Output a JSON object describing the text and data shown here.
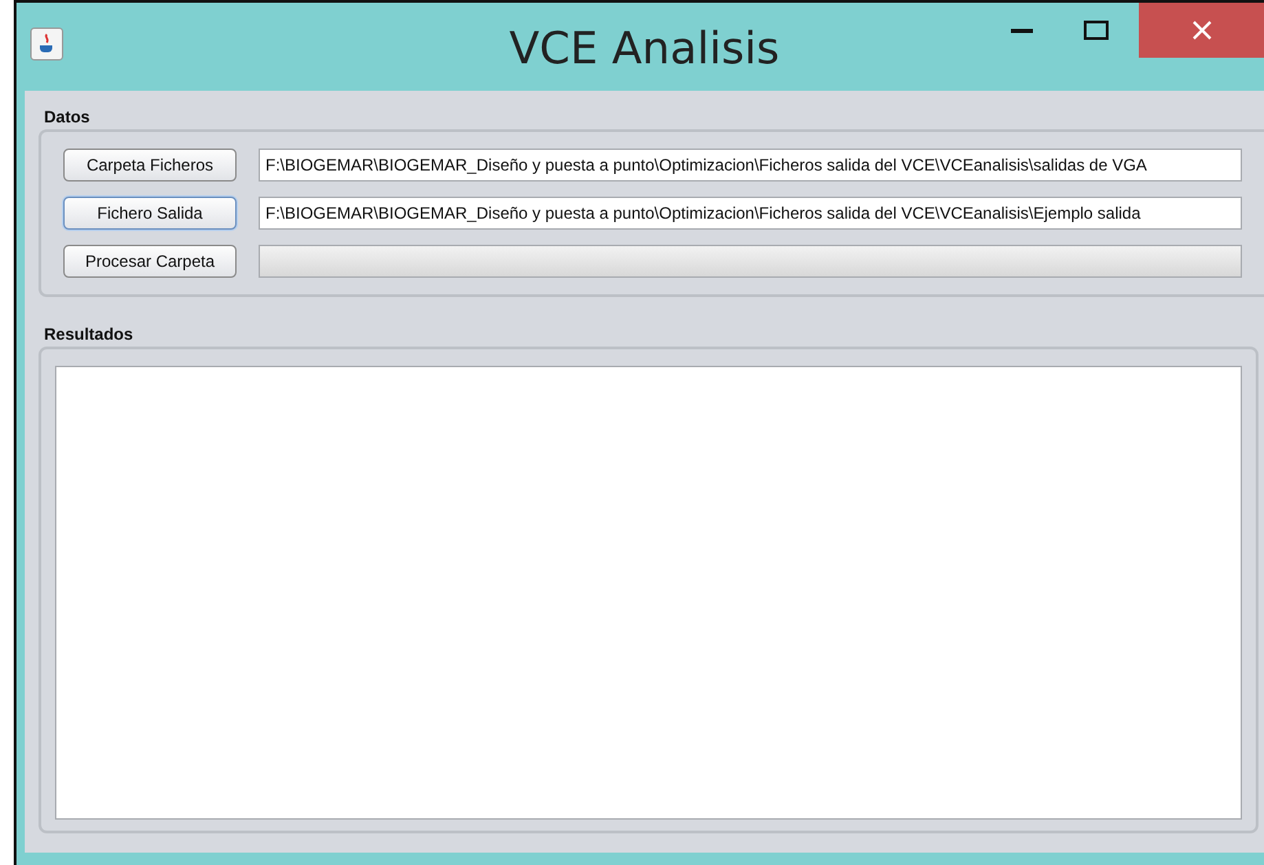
{
  "window": {
    "title": "VCE Analisis"
  },
  "datos": {
    "title": "Datos",
    "rows": [
      {
        "kind": "field",
        "button": "Carpeta Ficheros",
        "focused": false,
        "value": "F:\\BIOGEMAR\\BIOGEMAR_Diseño y puesta a punto\\Optimizacion\\Ficheros salida del VCE\\VCEanalisis\\salidas de VGA"
      },
      {
        "kind": "field",
        "button": "Fichero Salida",
        "focused": true,
        "value": "F:\\BIOGEMAR\\BIOGEMAR_Diseño y puesta a punto\\Optimizacion\\Ficheros salida del VCE\\VCEanalisis\\Ejemplo salida"
      },
      {
        "kind": "progress",
        "button": "Procesar Carpeta",
        "focused": false,
        "level": 0
      }
    ]
  },
  "resultados": {
    "title": "Resultados"
  }
}
